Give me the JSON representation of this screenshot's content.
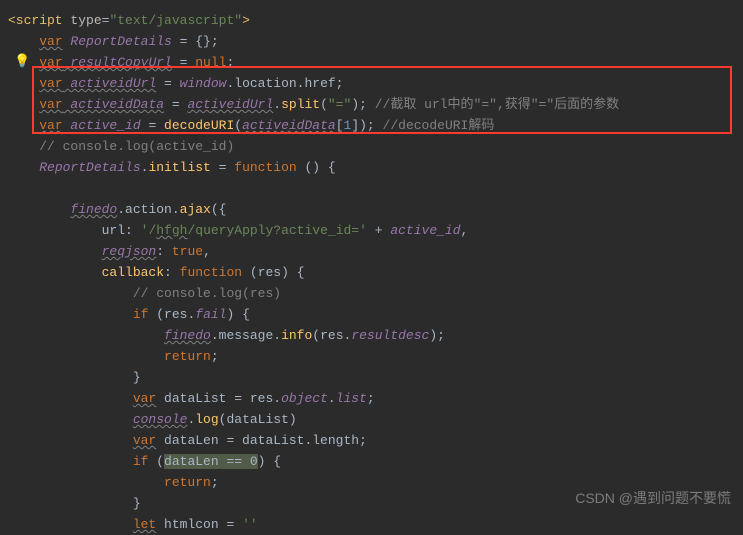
{
  "code": {
    "l1_open": "<script",
    "l1_attr": " type",
    "l1_eq": "=",
    "l1_val": "\"text/javascript\"",
    "l1_close": ">",
    "l2_var": "var",
    "l2_name": " ReportDetails",
    "l2_rest": " = {};",
    "l3_var": "var",
    "l3_name": " resultCopyUrl",
    "l3_rest": " = ",
    "l3_null": "null",
    "l3_semi": ";",
    "l4_var": "var",
    "l4_name": " activeidUrl",
    "l4_eq": " = ",
    "l4_win": "window",
    "l4_loc": ".location.href;",
    "l5_var": "var",
    "l5_name": " activeidData",
    "l5_eq": " = ",
    "l5_url": "activeidUrl",
    "l5_dot": ".",
    "l5_split": "split",
    "l5_p1": "(",
    "l5_str": "\"=\"",
    "l5_p2": "); ",
    "l5_com": "//截取 url中的\"=\",获得\"=\"后面的参数",
    "l6_var": "var",
    "l6_name": " active_id",
    "l6_eq": " = ",
    "l6_dec": "decodeURI",
    "l6_p1": "(",
    "l6_data": "activeidData",
    "l6_br1": "[",
    "l6_num": "1",
    "l6_br2": "]); ",
    "l6_com": "//decodeURI解码",
    "l7": "// console.log(active_id)",
    "l8_rd": "ReportDetails",
    "l8_dot": ".",
    "l8_init": "initlist",
    "l8_eq": " = ",
    "l8_fn": "function",
    "l8_rest": " () {",
    "l10_fin": "finedo",
    "l10_act": ".action.",
    "l10_ajax": "ajax",
    "l10_p": "({",
    "l11_url": "url",
    "l11_c": ": ",
    "l11_s1": "'/",
    "l11_hf": "hfgh",
    "l11_s2": "/queryApply?active_id='",
    "l11_pl": " + ",
    "l11_ai": "active_id",
    "l11_cm": ",",
    "l12_rj": "reqjson",
    "l12_c": ": ",
    "l12_t": "true",
    "l12_cm": ",",
    "l13_cb": "callback",
    "l13_c": ": ",
    "l13_fn": "function",
    "l13_p1": " (",
    "l13_res": "res",
    "l13_p2": ") {",
    "l14": "// console.log(res)",
    "l15_if": "if",
    "l15_p1": " (",
    "l15_res": "res",
    "l15_dot": ".",
    "l15_fail": "fail",
    "l15_p2": ") {",
    "l16_fin": "finedo",
    "l16_msg": ".message.",
    "l16_info": "info",
    "l16_p1": "(",
    "l16_res": "res",
    "l16_dot": ".",
    "l16_rd": "resultdesc",
    "l16_p2": ");",
    "l17_ret": "return",
    "l17_s": ";",
    "l18": "}",
    "l19_var": "var",
    "l19_dl": " dataList = ",
    "l19_res": "res",
    "l19_dot1": ".",
    "l19_obj": "object",
    "l19_dot2": ".",
    "l19_list": "list",
    "l19_s": ";",
    "l20_con": "console",
    "l20_dot": ".",
    "l20_log": "log",
    "l20_p1": "(",
    "l20_dl": "dataList",
    "l20_p2": ")",
    "l21_var": "var",
    "l21_rest": " dataLen = dataList.length;",
    "l22_if": "if",
    "l22_p1": " (",
    "l22_hl": "dataLen == 0",
    "l22_p2": ") {",
    "l23_ret": "return",
    "l23_s": ";",
    "l24": "}",
    "l25_let": "let",
    "l25_rest": " htmlcon = ",
    "l25_str": "''"
  },
  "watermark": "CSDN @遇到问题不要慌"
}
